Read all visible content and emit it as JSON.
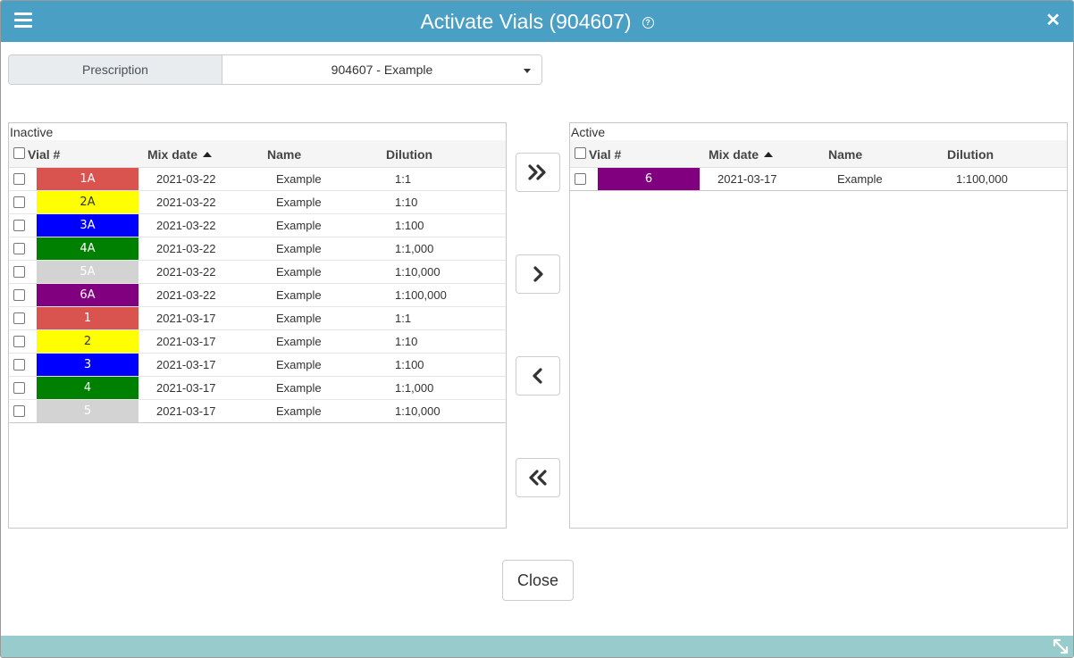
{
  "title": "Activate Vials (904607)",
  "prescription": {
    "label": "Prescription",
    "value": "904607 - Example"
  },
  "columns": {
    "vial": "Vial #",
    "mix_date": "Mix date",
    "name": "Name",
    "dilution": "Dilution"
  },
  "inactive": {
    "title": "Inactive",
    "rows": [
      {
        "vial": "1A",
        "color": "#d9534f",
        "text_color": "#ffffff",
        "mix_date": "2021-03-22",
        "name": "Example",
        "dilution": "1:1"
      },
      {
        "vial": "2A",
        "color": "#ffff00",
        "text_color": "#333333",
        "mix_date": "2021-03-22",
        "name": "Example",
        "dilution": "1:10"
      },
      {
        "vial": "3A",
        "color": "#0000ff",
        "text_color": "#ffffff",
        "mix_date": "2021-03-22",
        "name": "Example",
        "dilution": "1:100"
      },
      {
        "vial": "4A",
        "color": "#008000",
        "text_color": "#ffffff",
        "mix_date": "2021-03-22",
        "name": "Example",
        "dilution": "1:1,000"
      },
      {
        "vial": "5A",
        "color": "#d3d3d3",
        "text_color": "#ffffff",
        "mix_date": "2021-03-22",
        "name": "Example",
        "dilution": "1:10,000"
      },
      {
        "vial": "6A",
        "color": "#800080",
        "text_color": "#ffffff",
        "mix_date": "2021-03-22",
        "name": "Example",
        "dilution": "1:100,000"
      },
      {
        "vial": "1",
        "color": "#d9534f",
        "text_color": "#ffffff",
        "mix_date": "2021-03-17",
        "name": "Example",
        "dilution": "1:1"
      },
      {
        "vial": "2",
        "color": "#ffff00",
        "text_color": "#333333",
        "mix_date": "2021-03-17",
        "name": "Example",
        "dilution": "1:10"
      },
      {
        "vial": "3",
        "color": "#0000ff",
        "text_color": "#ffffff",
        "mix_date": "2021-03-17",
        "name": "Example",
        "dilution": "1:100"
      },
      {
        "vial": "4",
        "color": "#008000",
        "text_color": "#ffffff",
        "mix_date": "2021-03-17",
        "name": "Example",
        "dilution": "1:1,000"
      },
      {
        "vial": "5",
        "color": "#d3d3d3",
        "text_color": "#ffffff",
        "mix_date": "2021-03-17",
        "name": "Example",
        "dilution": "1:10,000"
      }
    ]
  },
  "active": {
    "title": "Active",
    "rows": [
      {
        "vial": "6",
        "color": "#800080",
        "text_color": "#ffffff",
        "mix_date": "2021-03-17",
        "name": "Example",
        "dilution": "1:100,000"
      }
    ]
  },
  "buttons": {
    "close": "Close"
  },
  "colors": {
    "titlebar": "#4a9fc4",
    "footer": "#97cbcc"
  }
}
